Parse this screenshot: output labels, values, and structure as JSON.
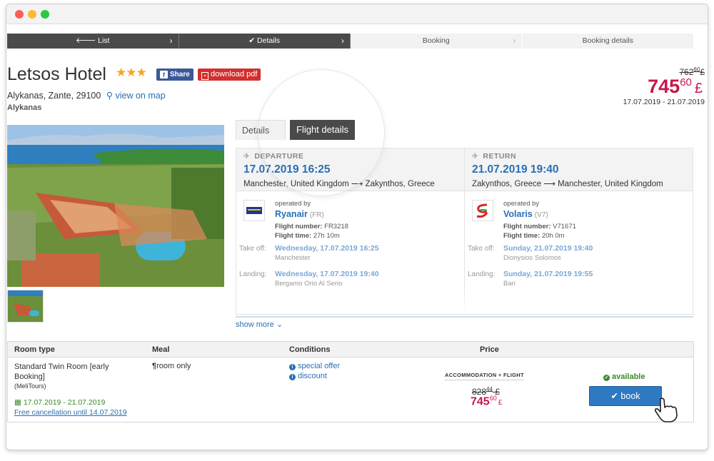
{
  "steps": [
    {
      "label": "List",
      "icon": "arrow-left-icon"
    },
    {
      "label": "Details",
      "icon": "check-icon"
    },
    {
      "label": "Booking"
    },
    {
      "label": "Booking details"
    }
  ],
  "hotel": {
    "name": "Letsos Hotel",
    "stars": "★★★",
    "share_label": "Share",
    "pdf_label": "download pdf",
    "address": "Alykanas, Zante, 29100",
    "map_label": "view on map",
    "region": "Alykanas"
  },
  "price_summary": {
    "old_main": "762",
    "old_cents": "60",
    "old_currency": "£",
    "new_main": "745",
    "new_cents": "60",
    "new_currency": "£",
    "dates": "17.07.2019 - 21.07.2019"
  },
  "tabs": [
    {
      "label": "Details"
    },
    {
      "label": "Flight details",
      "active": true
    }
  ],
  "flights": {
    "departure": {
      "label": "DEPARTURE",
      "datetime": "17.07.2019 16:25",
      "from": "Manchester, United Kingdom",
      "to": "Zakynthos, Greece",
      "operated_by_label": "operated by",
      "airline": "Ryanair",
      "code": "(FR)",
      "flight_number_label": "Flight number:",
      "flight_number": "FR3218",
      "flight_time_label": "Flight time:",
      "flight_time": "27h 10m",
      "takeoff_label": "Take off:",
      "takeoff_date": "Wednesday, 17.07.2019 16:25",
      "takeoff_airport": "Manchester",
      "landing_label": "Landing:",
      "landing_date": "Wednesday, 17.07.2019 19:40",
      "landing_airport": "Bergamo Orio Al Serio"
    },
    "return": {
      "label": "RETURN",
      "datetime": "21.07.2019 19:40",
      "from": "Zakynthos, Greece",
      "to": "Manchester, United Kingdom",
      "operated_by_label": "operated by",
      "airline": "Volaris",
      "code": "(V7)",
      "flight_number_label": "Flight number:",
      "flight_number": "V71671",
      "flight_time_label": "Flight time:",
      "flight_time": "20h 0m",
      "takeoff_label": "Take off:",
      "takeoff_date": "Sunday, 21.07.2019 19:40",
      "takeoff_airport": "Dionysios Solomos",
      "landing_label": "Landing:",
      "landing_date": "Sunday, 21.07.2019 19:55",
      "landing_airport": "Bari"
    },
    "show_more": "show more"
  },
  "rooms_table": {
    "headers": [
      "Room type",
      "Meal",
      "Conditions",
      "Price"
    ],
    "row": {
      "room_name": "Standard Twin Room [early Booking]",
      "operator": "(MeliTours)",
      "dates": "17.07.2019 - 21.07.2019",
      "cancellation": "Free cancellation until 14.07.2019",
      "meal": "room only",
      "conditions": [
        "special offer",
        "discount"
      ],
      "price_label": "ACCOMMODATION + FLIGHT",
      "old_main": "828",
      "old_cents": "44",
      "old_currency": "£",
      "new_main": "745",
      "new_cents": "60",
      "new_currency": "£",
      "availability": "available",
      "book_label": "book"
    }
  },
  "colors": {
    "accent_blue": "#2a6fb3",
    "price_red": "#c8174a",
    "available_green": "#3a8a2a",
    "step_dark": "#4a4a4a",
    "book_button": "#2f79c2"
  }
}
